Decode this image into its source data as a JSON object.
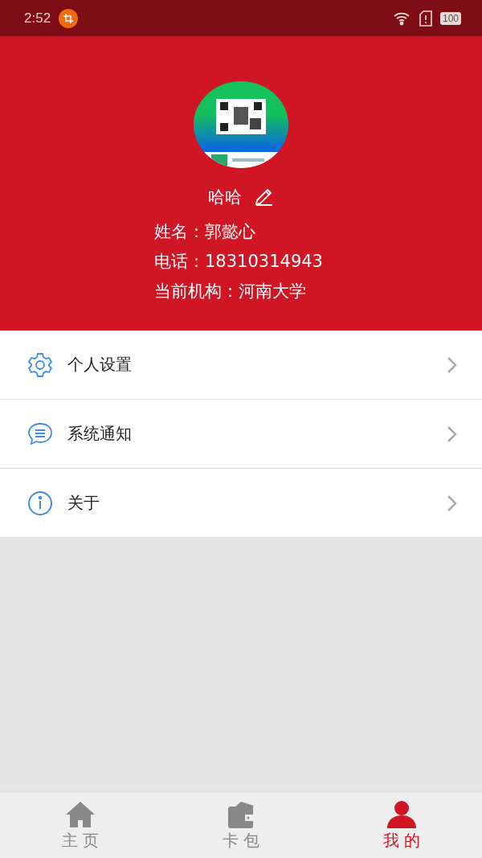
{
  "status_bar": {
    "time": "2:52",
    "battery": "100"
  },
  "profile": {
    "nickname": "哈哈",
    "fields": [
      {
        "label": "姓名：",
        "value": "郭懿心"
      },
      {
        "label": "电话：",
        "value": "18310314943"
      },
      {
        "label": "当前机构：",
        "value": "河南大学"
      }
    ]
  },
  "menu": [
    {
      "kind": "settings",
      "label": "个人设置"
    },
    {
      "kind": "notice",
      "label": "系统通知"
    },
    {
      "kind": "info",
      "label": "关于"
    }
  ],
  "tab_bar": [
    {
      "kind": "home",
      "label": "主 页",
      "selected": false
    },
    {
      "kind": "wallet",
      "label": "卡 包",
      "selected": false
    },
    {
      "kind": "user",
      "label": "我 的",
      "selected": true
    }
  ]
}
